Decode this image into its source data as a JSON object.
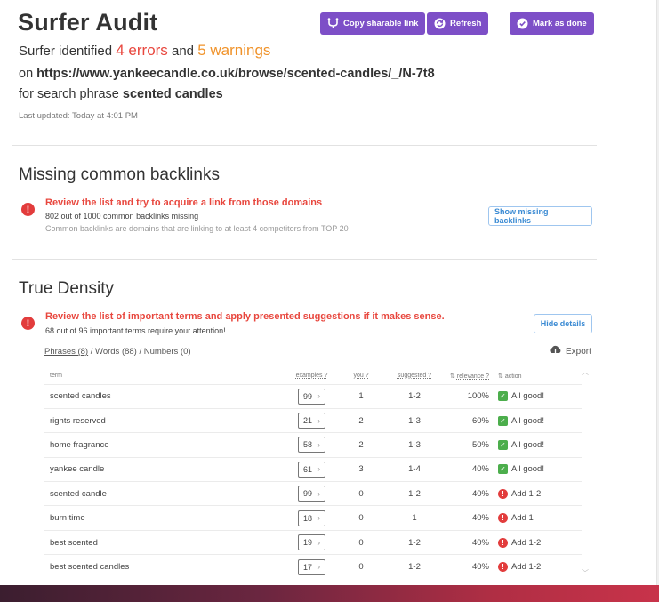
{
  "header": {
    "title": "Surfer Audit",
    "summary_prefix": "Surfer identified ",
    "errors": "4 errors",
    "summary_mid": " and ",
    "warnings": "5 warnings",
    "url_prefix": "on ",
    "url": "https://www.yankeecandle.co.uk/browse/scented-candles/_/N-7t8",
    "phrase_prefix": "for search phrase ",
    "phrase": "scented candles",
    "last_updated": "Last updated: Today at 4:01 PM"
  },
  "toolbar": {
    "copy_label": "Copy sharable link",
    "refresh_label": "Refresh",
    "done_label": "Mark as done"
  },
  "backlinks": {
    "heading": "Missing common backlinks",
    "alert_title": "Review the list and try to acquire a link from those domains",
    "alert_sub": "802 out of 1000 common backlinks missing",
    "alert_note": "Common backlinks are domains that are linking to at least 4 competitors from TOP 20",
    "button_label": "Show missing backlinks"
  },
  "density": {
    "heading": "True Density",
    "alert_title": "Review the list of important terms and apply presented suggestions if it makes sense.",
    "alert_sub": "68 out of 96 important terms require your attention!",
    "button_label": "Hide details",
    "filter_phrases": "Phrases (8)",
    "filter_rest": " / Words (88) / Numbers (0)",
    "export_label": "Export",
    "columns": {
      "term": "term",
      "examples": "examples ?",
      "you": "you ?",
      "suggested": "suggested ?",
      "relevance": "relevance ?",
      "action": "action"
    },
    "rows": [
      {
        "term": "scented candles",
        "examples": "99",
        "you": "1",
        "suggested": "1-2",
        "relevance": "100%",
        "status": "ok",
        "action": "All good!"
      },
      {
        "term": "rights reserved",
        "examples": "21",
        "you": "2",
        "suggested": "1-3",
        "relevance": "60%",
        "status": "ok",
        "action": "All good!"
      },
      {
        "term": "home fragrance",
        "examples": "58",
        "you": "2",
        "suggested": "1-3",
        "relevance": "50%",
        "status": "ok",
        "action": "All good!"
      },
      {
        "term": "yankee candle",
        "examples": "61",
        "you": "3",
        "suggested": "1-4",
        "relevance": "40%",
        "status": "ok",
        "action": "All good!"
      },
      {
        "term": "scented candle",
        "examples": "99",
        "you": "0",
        "suggested": "1-2",
        "relevance": "40%",
        "status": "bad",
        "action": "Add 1-2"
      },
      {
        "term": "burn time",
        "examples": "18",
        "you": "0",
        "suggested": "1",
        "relevance": "40%",
        "status": "bad",
        "action": "Add 1"
      },
      {
        "term": "best scented",
        "examples": "19",
        "you": "0",
        "suggested": "1-2",
        "relevance": "40%",
        "status": "bad",
        "action": "Add 1-2"
      },
      {
        "term": "best scented candles",
        "examples": "17",
        "you": "0",
        "suggested": "1-2",
        "relevance": "40%",
        "status": "bad",
        "action": "Add 1-2"
      }
    ]
  },
  "colors": {
    "accent_purple": "#7d4fc7",
    "error_red": "#e8473e",
    "warning_orange": "#f0932b",
    "ok_green": "#4cae4c",
    "link_blue": "#3a8ad3"
  }
}
